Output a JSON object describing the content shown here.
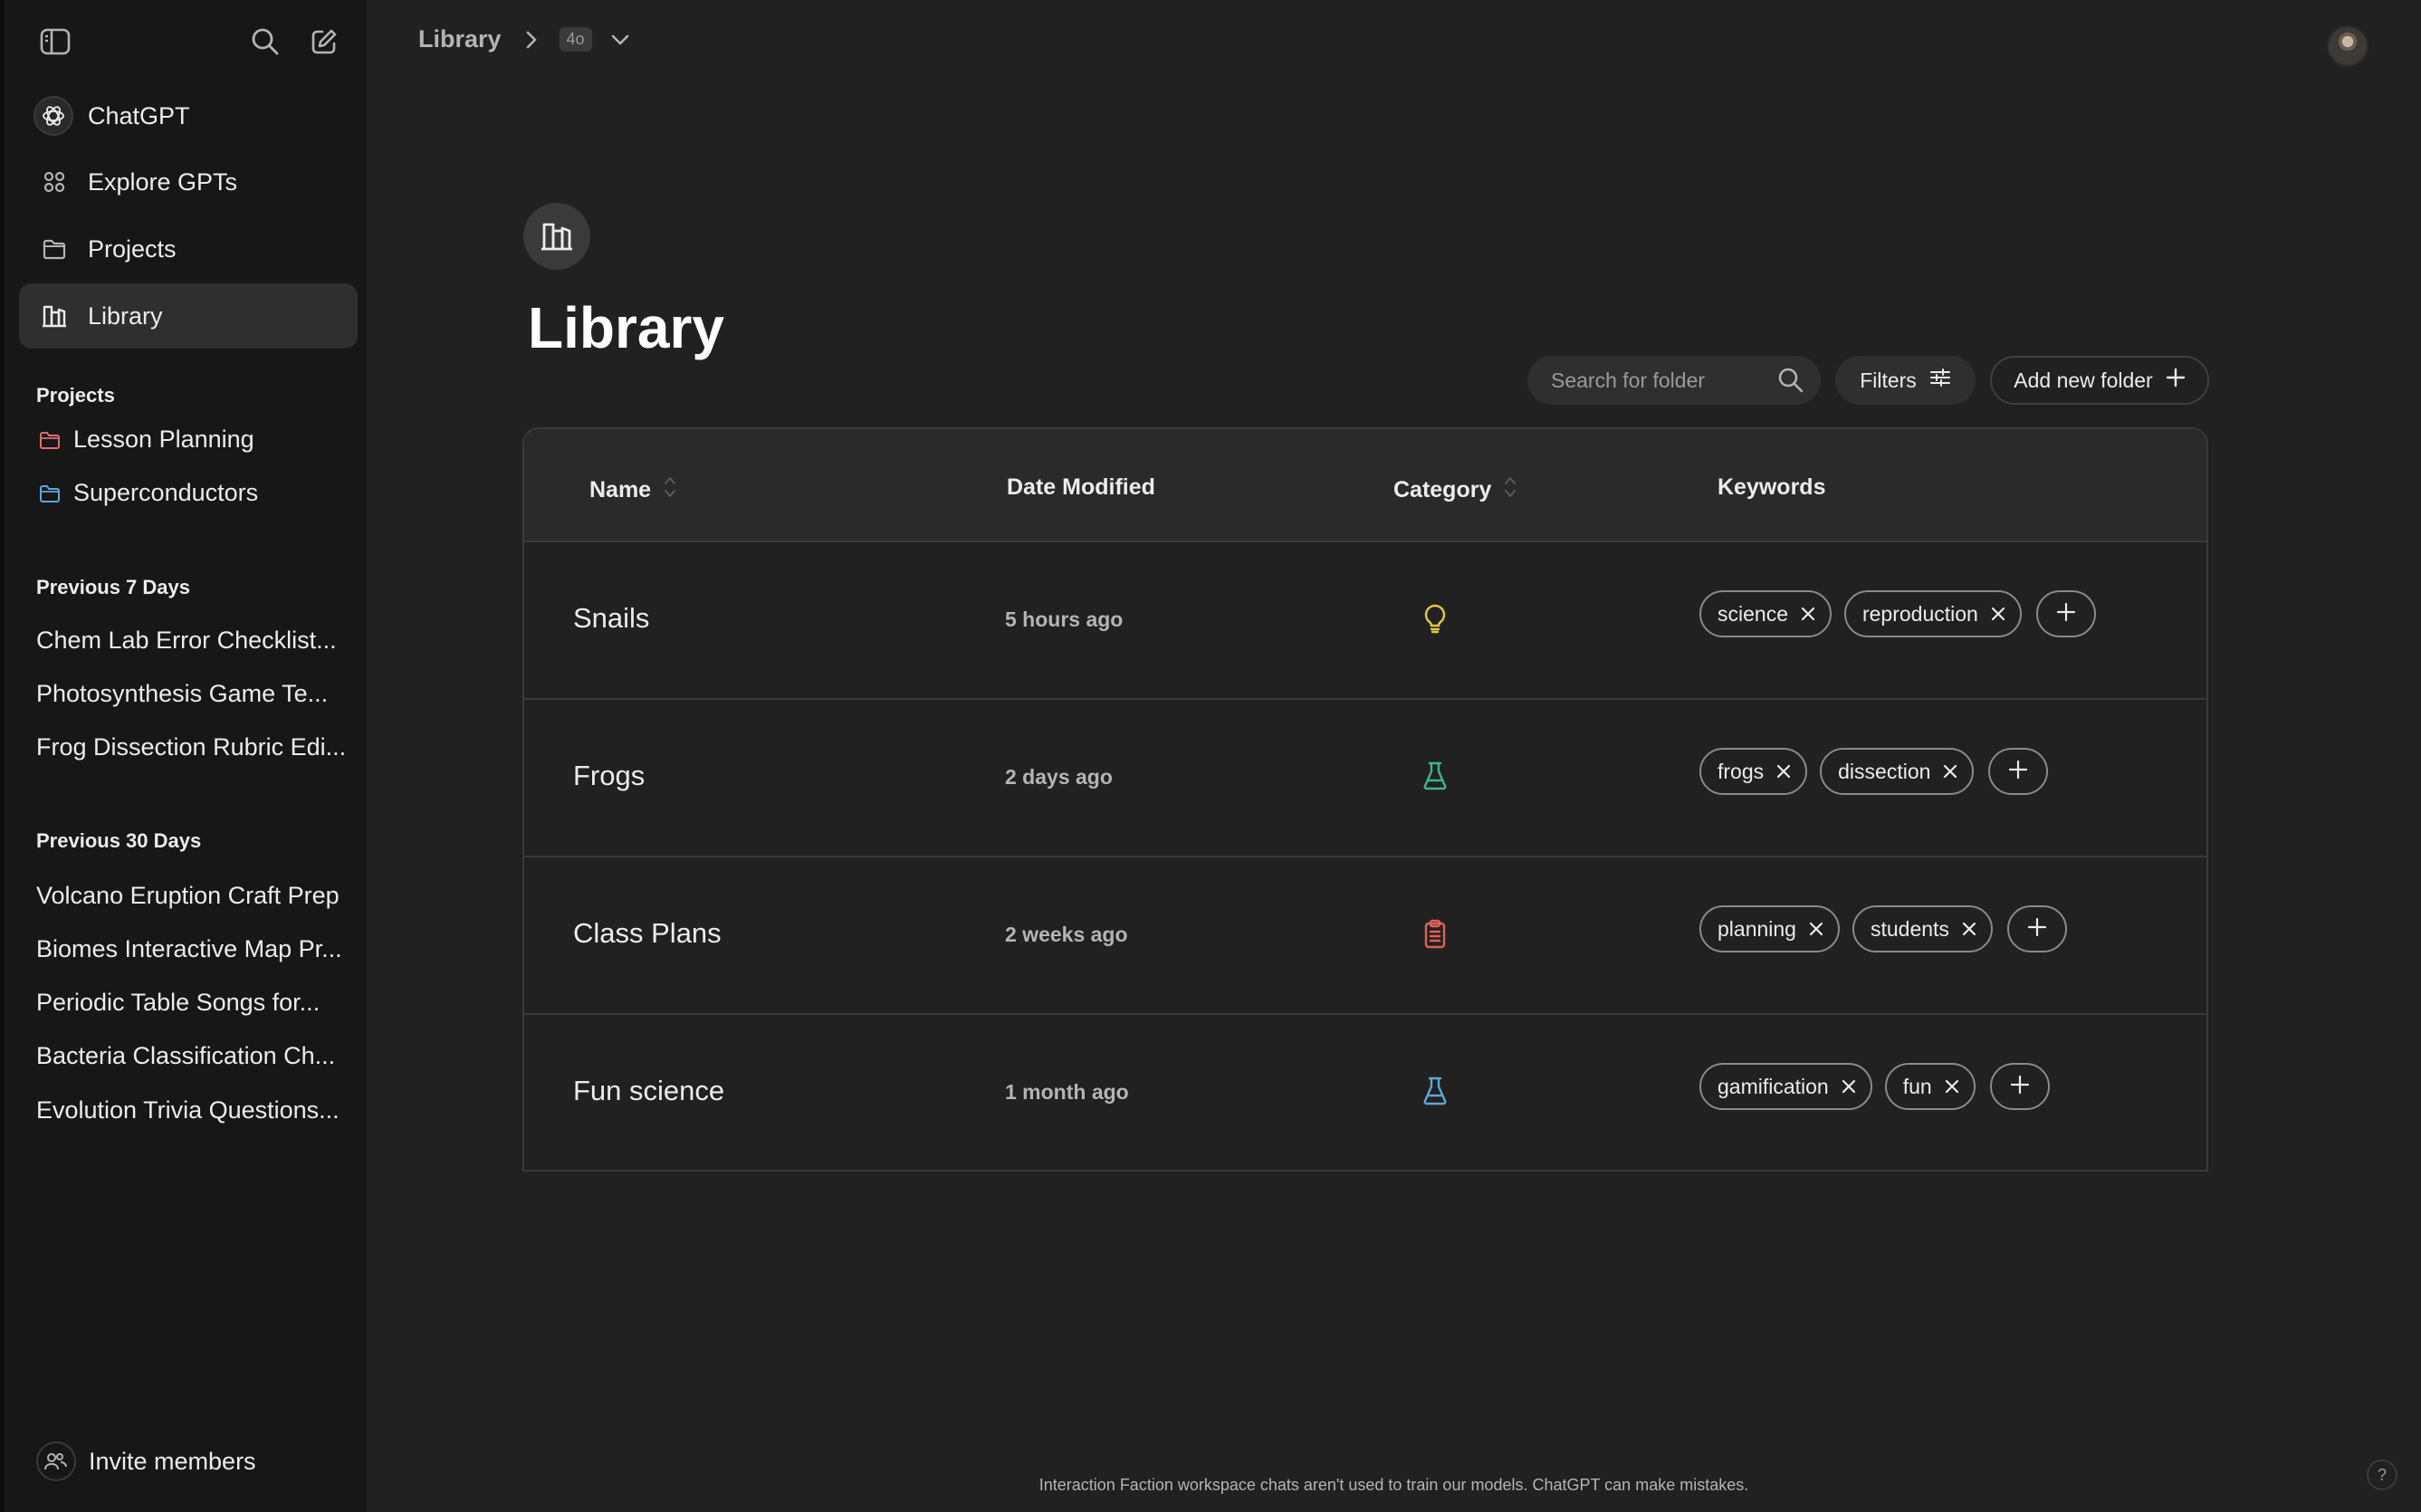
{
  "sidebar": {
    "toggle_icon": "sidebar-toggle-icon",
    "search_icon": "search-icon",
    "new_chat_icon": "compose-icon",
    "nav": [
      {
        "label": "ChatGPT",
        "icon": "openai-logo-icon"
      },
      {
        "label": "Explore GPTs",
        "icon": "grid-icon"
      },
      {
        "label": "Projects",
        "icon": "folder-icon"
      },
      {
        "label": "Library",
        "icon": "library-icon",
        "active": true
      }
    ],
    "projects_heading": "Projects",
    "projects": [
      {
        "label": "Lesson Planning",
        "color": "#e06c6c"
      },
      {
        "label": "Superconductors",
        "color": "#5fa8d3"
      }
    ],
    "prev7_heading": "Previous 7 Days",
    "prev7": [
      "Chem Lab Error Checklist...",
      "Photosynthesis Game Te...",
      "Frog Dissection Rubric Edi..."
    ],
    "prev30_heading": "Previous 30 Days",
    "prev30": [
      "Volcano Eruption Craft Prep",
      "Biomes Interactive Map Pr...",
      "Periodic Table Songs for...",
      "Bacteria Classification Ch...",
      "Evolution Trivia Questions..."
    ],
    "invite_label": "Invite members"
  },
  "header": {
    "breadcrumb": "Library",
    "model": "4o"
  },
  "page": {
    "title": "Library",
    "search_placeholder": "Search for folder",
    "filters_label": "Filters",
    "add_folder_label": "Add new folder"
  },
  "table": {
    "columns": {
      "name": "Name",
      "date": "Date Modified",
      "category": "Category",
      "keywords": "Keywords"
    },
    "rows": [
      {
        "name": "Snails",
        "date": "5 hours ago",
        "category_icon": "lightbulb-icon",
        "category_color": "#e8c547",
        "keywords": [
          "science",
          "reproduction"
        ]
      },
      {
        "name": "Frogs",
        "date": "2 days ago",
        "category_icon": "flask-icon",
        "category_color": "#3fb58a",
        "keywords": [
          "frogs",
          "dissection"
        ]
      },
      {
        "name": "Class Plans",
        "date": "2 weeks ago",
        "category_icon": "clipboard-icon",
        "category_color": "#e0605a",
        "keywords": [
          "planning",
          "students"
        ]
      },
      {
        "name": "Fun science",
        "date": "1 month ago",
        "category_icon": "flask-icon",
        "category_color": "#5fa8d3",
        "keywords": [
          "gamification",
          "fun"
        ]
      }
    ]
  },
  "footer": {
    "note": "Interaction Faction workspace chats aren't used to train our models. ChatGPT can make mistakes.",
    "help": "?"
  }
}
